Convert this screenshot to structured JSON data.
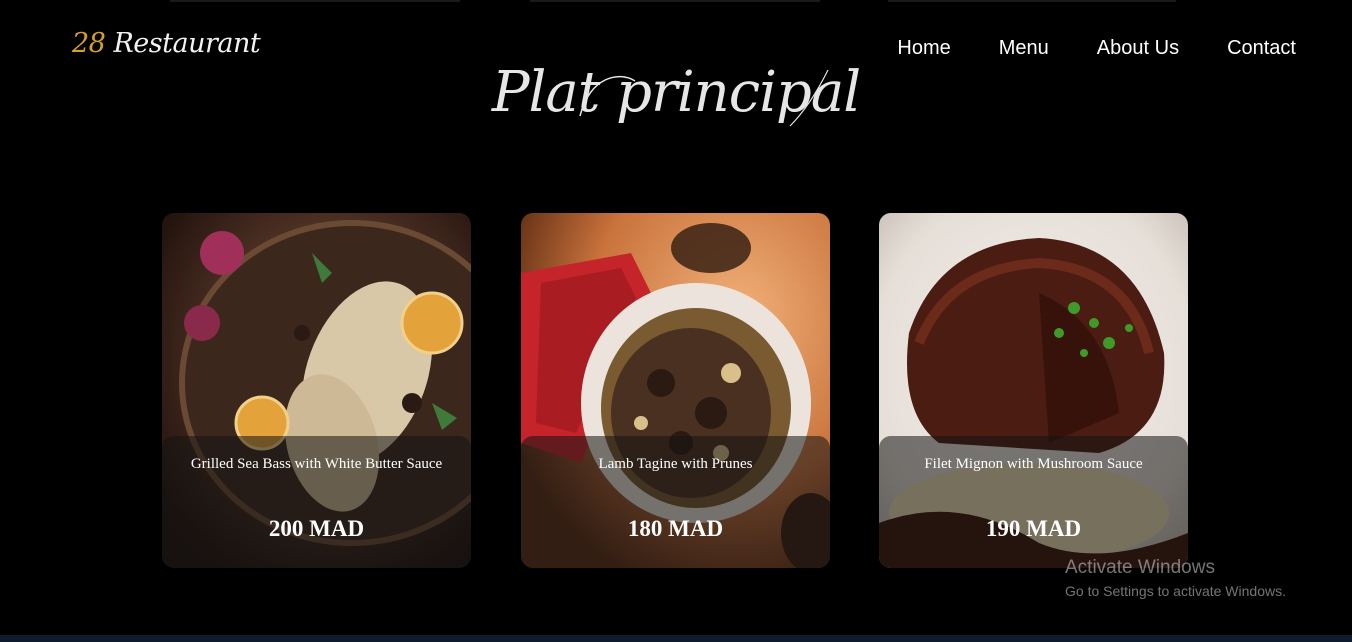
{
  "brand": {
    "number": "28",
    "name": "Restaurant"
  },
  "nav": {
    "items": [
      "Home",
      "Menu",
      "About Us",
      "Contact"
    ]
  },
  "section": {
    "title": "Plat principal"
  },
  "dishes": [
    {
      "name": "Grilled Sea Bass with White Butter Sauce",
      "price": "200 MAD"
    },
    {
      "name": "Lamb Tagine with Prunes",
      "price": "180 MAD"
    },
    {
      "name": "Filet Mignon with Mushroom Sauce",
      "price": "190 MAD"
    }
  ],
  "watermark": {
    "line1": "Activate Windows",
    "line2": "Go to Settings to activate Windows."
  },
  "colors": {
    "background": "#000000",
    "accent": "#d4a02a",
    "text": "#ffffff"
  }
}
